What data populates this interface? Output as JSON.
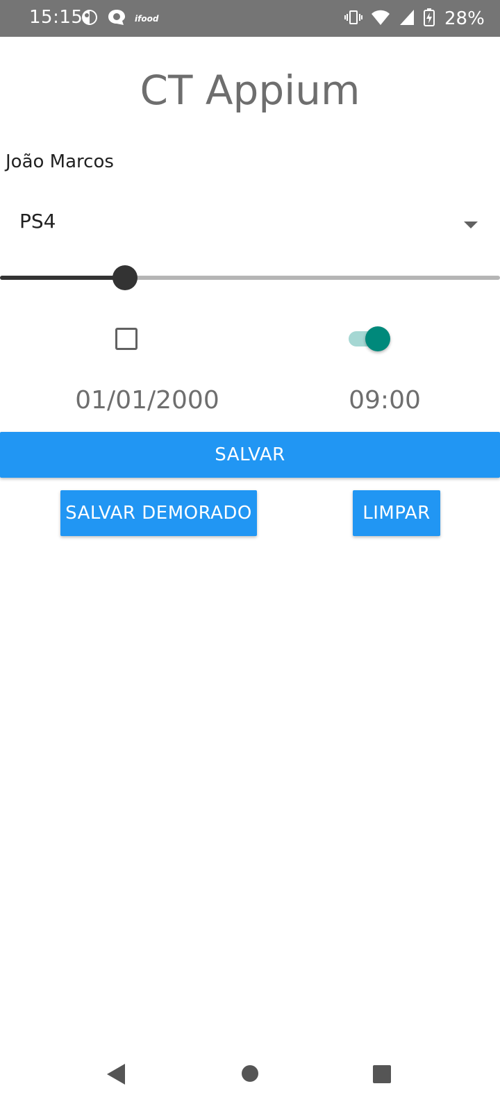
{
  "status_bar": {
    "time": "15:15",
    "ifood_label": "ifood",
    "battery": "28%",
    "icons": [
      "notification-app-icon",
      "chat-icon",
      "ifood-icon",
      "vibrate-icon",
      "wifi-icon",
      "signal-icon",
      "battery-charging-icon"
    ]
  },
  "app": {
    "title": "CT Appium"
  },
  "form": {
    "name_value": "João Marcos",
    "console_selected": "PS4",
    "slider_fraction": 0.25,
    "checkbox_checked": false,
    "switch_on": true,
    "date": "01/01/2000",
    "time": "09:00"
  },
  "buttons": {
    "save": "SALVAR",
    "save_delayed": "SALVAR DEMORADO",
    "clear": "LIMPAR"
  },
  "colors": {
    "status_bar": "#757575",
    "primary_button": "#2196f3",
    "switch_accent": "#00897b",
    "slider_active": "#333333"
  },
  "nav_bar": {
    "icons": [
      "back-icon",
      "home-icon",
      "recents-icon"
    ]
  }
}
